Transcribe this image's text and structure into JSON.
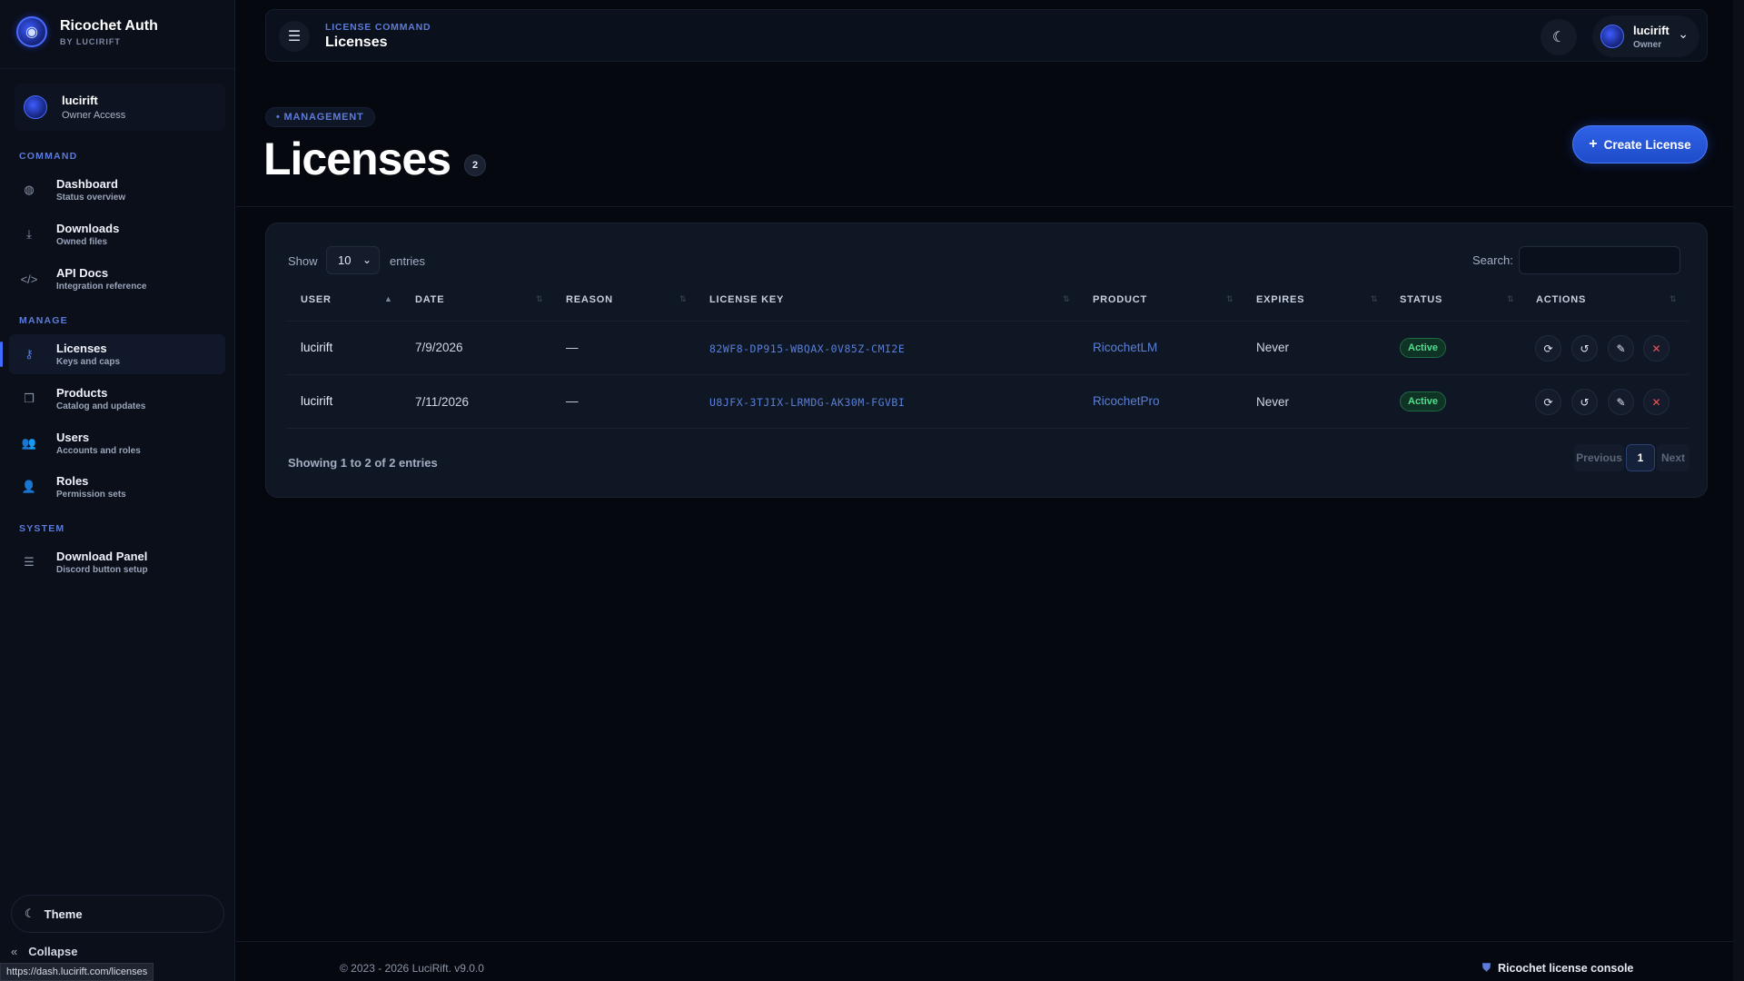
{
  "brand": {
    "name": "Ricochet Auth",
    "sub": "BY LUCIRIFT"
  },
  "sidebar": {
    "user": {
      "name": "lucirift",
      "role": "Owner Access"
    },
    "sections": {
      "command": "COMMAND",
      "manage": "MANAGE",
      "system": "SYSTEM"
    },
    "items": [
      {
        "title": "Dashboard",
        "sub": "Status overview",
        "icon": "gauge-icon"
      },
      {
        "title": "Downloads",
        "sub": "Owned files",
        "icon": "download-icon"
      },
      {
        "title": "API Docs",
        "sub": "Integration reference",
        "icon": "code-icon"
      },
      {
        "title": "Licenses",
        "sub": "Keys and caps",
        "icon": "key-icon",
        "active": true
      },
      {
        "title": "Products",
        "sub": "Catalog and updates",
        "icon": "box-icon"
      },
      {
        "title": "Users",
        "sub": "Accounts and roles",
        "icon": "users-icon"
      },
      {
        "title": "Roles",
        "sub": "Permission sets",
        "icon": "user-shield-icon"
      },
      {
        "title": "Download Panel",
        "sub": "Discord button setup",
        "icon": "sliders-icon"
      }
    ],
    "theme_label": "Theme",
    "collapse_label": "Collapse",
    "status_url": "https://dash.lucirift.com/licenses"
  },
  "topbar": {
    "crumb": "LICENSE COMMAND",
    "title": "Licenses",
    "profile": {
      "name": "lucirift",
      "role": "Owner"
    }
  },
  "header": {
    "pill": "MANAGEMENT",
    "title": "Licenses",
    "count": "2",
    "create_label": "Create License"
  },
  "table": {
    "show_label": "Show",
    "page_size": "10",
    "entries_label": "entries",
    "search_label": "Search:",
    "search_value": "",
    "columns": [
      "USER",
      "DATE",
      "REASON",
      "LICENSE KEY",
      "PRODUCT",
      "EXPIRES",
      "STATUS",
      "ACTIONS"
    ],
    "rows": [
      {
        "user": "lucirift",
        "date": "7/9/2026",
        "reason": "—",
        "key": "82WF8-DP915-WBQAX-0V85Z-CMI2E",
        "product": "RicochetLM",
        "expires": "Never",
        "status": "Active"
      },
      {
        "user": "lucirift",
        "date": "7/11/2026",
        "reason": "—",
        "key": "U8JFX-3TJIX-LRMDG-AK30M-FGVBI",
        "product": "RicochetPro",
        "expires": "Never",
        "status": "Active"
      }
    ],
    "showing": "Showing 1 to 2 of 2 entries",
    "pager": {
      "prev": "Previous",
      "page": "1",
      "next": "Next"
    }
  },
  "footer": {
    "copyright": "© 2023 - 2026 LuciRift. v9.0.0",
    "console": "Ricochet license console"
  },
  "colors": {
    "accent": "#2f62e8",
    "label_blue": "#5d7bd8",
    "status_green": "#4fe08f",
    "danger": "#e85858"
  }
}
